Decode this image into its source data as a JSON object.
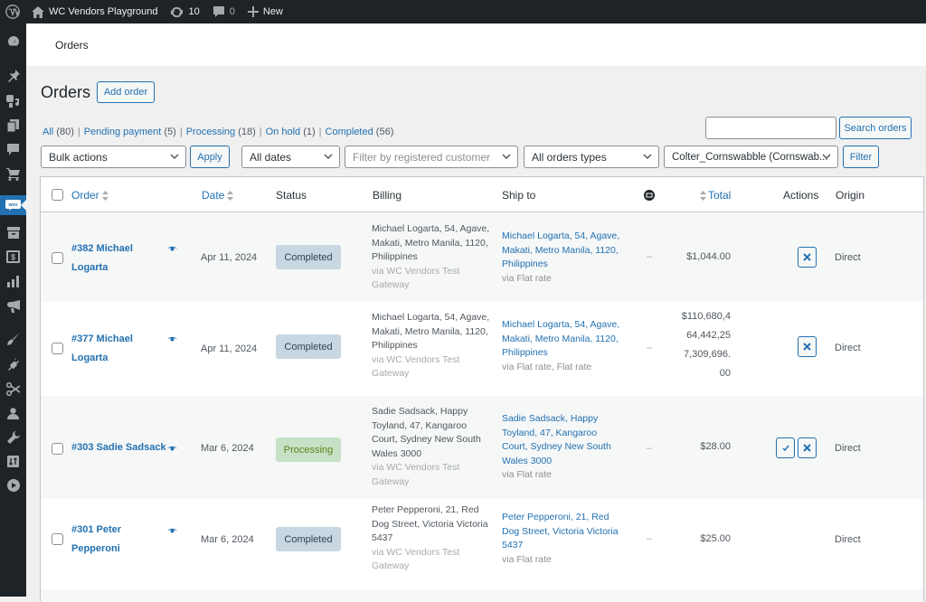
{
  "adminbar": {
    "site_name": "WC Vendors Playground",
    "updates_count": "10",
    "comments_count": "0",
    "new_label": "New"
  },
  "sidebar": {
    "items": [
      {
        "icon": "dashboard-icon"
      },
      {
        "icon": "pin-icon"
      },
      {
        "icon": "media-icon"
      },
      {
        "icon": "pages-icon"
      },
      {
        "icon": "comments-icon"
      },
      {
        "icon": "cart-icon"
      },
      {
        "icon": "woocommerce-icon",
        "active": true
      },
      {
        "icon": "archive-icon"
      },
      {
        "icon": "dollar-icon"
      },
      {
        "icon": "analytics-icon"
      },
      {
        "icon": "megaphone-icon"
      },
      {
        "icon": "paintbrush-icon"
      },
      {
        "icon": "plugin-icon"
      },
      {
        "icon": "scissors-icon"
      },
      {
        "icon": "user-icon"
      },
      {
        "icon": "wrench-icon"
      },
      {
        "icon": "settings-icon"
      },
      {
        "icon": "play-icon"
      }
    ]
  },
  "header": {
    "title": "Orders"
  },
  "page": {
    "title": "Orders",
    "add_order_label": "Add order"
  },
  "filters_views": [
    {
      "label": "All",
      "count": "(80)"
    },
    {
      "label": "Pending payment",
      "count": "(5)"
    },
    {
      "label": "Processing",
      "count": "(18)"
    },
    {
      "label": "On hold",
      "count": "(1)"
    },
    {
      "label": "Completed",
      "count": "(56)"
    }
  ],
  "search": {
    "value": "",
    "button_label": "Search orders"
  },
  "toolbar": {
    "bulk_actions": "Bulk actions",
    "apply_label": "Apply",
    "dates": "All dates",
    "customer_placeholder": "Filter by registered customer",
    "order_types": "All orders types",
    "vendor": "Colter_Cornswabble (Cornswab...",
    "filter_label": "Filter"
  },
  "table": {
    "columns": {
      "order": "Order",
      "date": "Date",
      "status": "Status",
      "billing": "Billing",
      "ship_to": "Ship to",
      "total": "Total",
      "actions": "Actions",
      "origin": "Origin"
    },
    "rows": [
      {
        "order": "#382 Michael Logarta",
        "date": "Apr 11, 2024",
        "status": "Completed",
        "billing": "Michael Logarta, 54, Agave, Makati, Metro Manila, 1120, Philippines",
        "billing_via": "via WC Vendors Test Gateway",
        "ship": "Michael Logarta, 54, Agave, Makati, Metro Manila, 1120, Philippines",
        "ship_via": "via Flat rate",
        "dash": "–",
        "total": "$1,044.00",
        "origin": "Direct"
      },
      {
        "order": "#377 Michael Logarta",
        "date": "Apr 11, 2024",
        "status": "Completed",
        "billing": "Michael Logarta, 54, Agave, Makati, Metro Manila, 1120, Philippines",
        "billing_via": "via WC Vendors Test Gateway",
        "ship": "Michael Logarta, 54, Agave, Makati, Metro Manila, 1120, Philippines",
        "ship_via": "via Flat rate, Flat rate",
        "dash": "–",
        "total": "$110,680,464,442,257,309,696.00",
        "origin": "Direct"
      },
      {
        "order": "#303 Sadie Sadsack",
        "date": "Mar 6, 2024",
        "status": "Processing",
        "billing": "Sadie Sadsack, Happy Toyland, 47, Kangaroo Court, Sydney New South Wales 3000",
        "billing_via": "via WC Vendors Test Gateway",
        "ship": "Sadie Sadsack, Happy Toyland, 47, Kangaroo Court, Sydney New South Wales 3000",
        "ship_via": "via Flat rate",
        "dash": "–",
        "total": "$28.00",
        "origin": "Direct"
      },
      {
        "order": "#301 Peter Pepperoni",
        "date": "Mar 6, 2024",
        "status": "Completed",
        "billing": "Peter Pepperoni, 21, Red Dog Street, Victoria Victoria 5437",
        "billing_via": "via WC Vendors Test Gateway",
        "ship": "Peter Pepperoni, 21, Red Dog Street, Victoria Victoria 5437",
        "ship_via": "via Flat rate",
        "dash": "–",
        "total": "$25.00",
        "origin": "Direct"
      }
    ]
  },
  "colors": {
    "accent": "#2271b1",
    "adminbar": "#1d2327",
    "completed_bg": "#c8d7e1",
    "processing_bg": "#c6e1c6"
  }
}
